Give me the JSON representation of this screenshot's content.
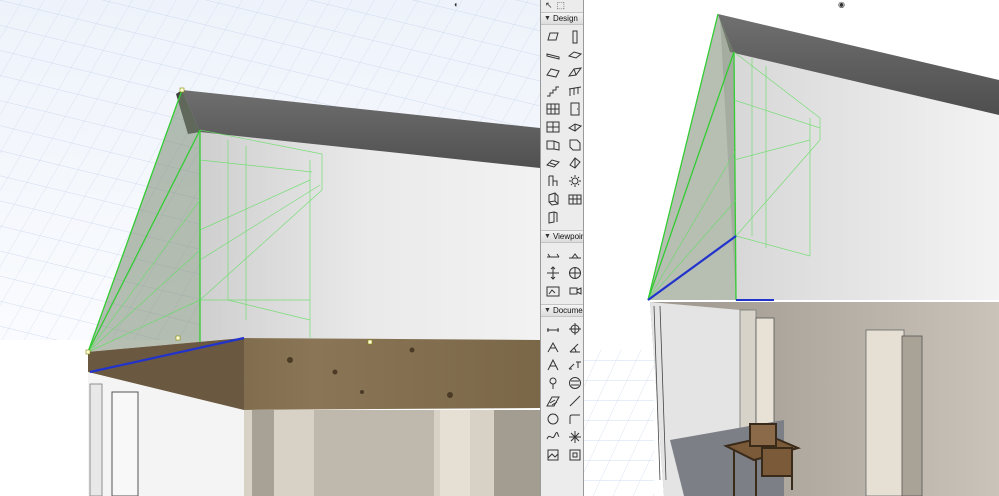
{
  "toolbox": {
    "top_icons": [
      "arrow-select-icon",
      "marquee-icon"
    ],
    "groups": [
      {
        "label": "Design",
        "tools": [
          "wall-icon",
          "column-icon",
          "beam-icon",
          "slab-icon",
          "roof-icon",
          "shell-icon",
          "stair-icon",
          "railing-icon",
          "curtain-wall-icon",
          "door-icon",
          "window-icon",
          "skylight-icon",
          "corner-window-icon",
          "wall-end-icon",
          "mesh-icon",
          "zone-icon",
          "object-icon",
          "lamp-icon",
          "morph-icon",
          "curtain-panel-icon",
          "column-frame-icon"
        ]
      },
      {
        "label": "Viewpoin",
        "tools": [
          "section-icon",
          "elevation-icon",
          "interior-elevation-icon",
          "worksheet-icon",
          "detail-icon",
          "camera-icon"
        ]
      },
      {
        "label": "Documen",
        "tools": [
          "dimension-icon",
          "level-dimension-icon",
          "radial-dimension-icon",
          "angle-dimension-icon",
          "text-icon",
          "label-icon",
          "spot-icon",
          "change-icon",
          "fill-icon",
          "line-icon",
          "circle-icon",
          "polyline-icon",
          "spline-icon",
          "hotspot-icon",
          "figure-icon",
          "drawing-icon"
        ]
      }
    ]
  },
  "nav_icons": [
    "orbit-icon",
    "eye-icon"
  ]
}
